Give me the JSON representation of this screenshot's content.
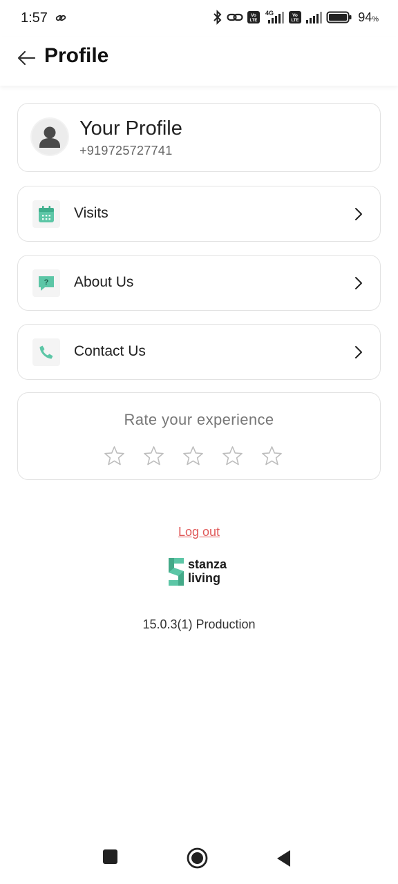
{
  "status_bar": {
    "time": "1:57",
    "battery_percent": "94",
    "battery_unit": "%",
    "icons": [
      "link-icon",
      "bluetooth-icon",
      "hotspot-icon",
      "volte-icon",
      "signal-4g-icon",
      "volte-icon",
      "signal-icon",
      "battery-icon"
    ],
    "network_label": "4G",
    "volte_label": "Vo LTE"
  },
  "header": {
    "title": "Profile",
    "back_icon": "back-arrow-icon"
  },
  "profile": {
    "title": "Your Profile",
    "phone": "+919725727741",
    "avatar_icon": "user-avatar-icon"
  },
  "menu": {
    "items": [
      {
        "label": "Visits",
        "icon": "calendar-icon"
      },
      {
        "label": "About Us",
        "icon": "question-chat-icon"
      },
      {
        "label": "Contact Us",
        "icon": "phone-icon"
      }
    ]
  },
  "rating": {
    "title": "Rate your experience",
    "max_stars": 5,
    "selected": 0
  },
  "logout_label": "Log out",
  "brand": {
    "line1": "stanza",
    "line2": "living"
  },
  "version": "15.0.3(1) Production",
  "colors": {
    "accent": "#5cc6a6",
    "logout": "#e05a5a",
    "card_border": "#e2e2e2"
  }
}
